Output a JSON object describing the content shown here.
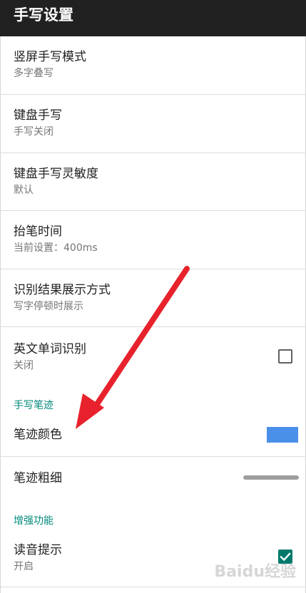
{
  "app_bar": {
    "title": "手写设置"
  },
  "settings": [
    {
      "title": "竖屏手写模式",
      "summary": "多字叠写"
    },
    {
      "title": "键盘手写",
      "summary": "手写关闭"
    },
    {
      "title": "键盘手写灵敏度",
      "summary": "默认"
    },
    {
      "title": "抬笔时间",
      "summary": "当前设置：400ms"
    },
    {
      "title": "识别结果展示方式",
      "summary": "写字停顿时展示"
    },
    {
      "title": "英文单词识别",
      "summary": "关闭",
      "checked": false
    }
  ],
  "section_handwriting": {
    "header": "手写笔迹",
    "stroke_color": {
      "title": "笔迹颜色",
      "value_color": "#4a8fe8"
    },
    "stroke_width": {
      "title": "笔迹粗细"
    }
  },
  "section_enhance": {
    "header": "增强功能",
    "voice_hint": {
      "title": "读音提示",
      "summary": "开启",
      "checked": true
    }
  },
  "annotation": {
    "arrow_color": "#e8222c"
  },
  "watermark": "Baidu经验",
  "colors": {
    "app_bar": "#212121",
    "accent": "#00897b",
    "checkbox_checked": "#00796b"
  }
}
